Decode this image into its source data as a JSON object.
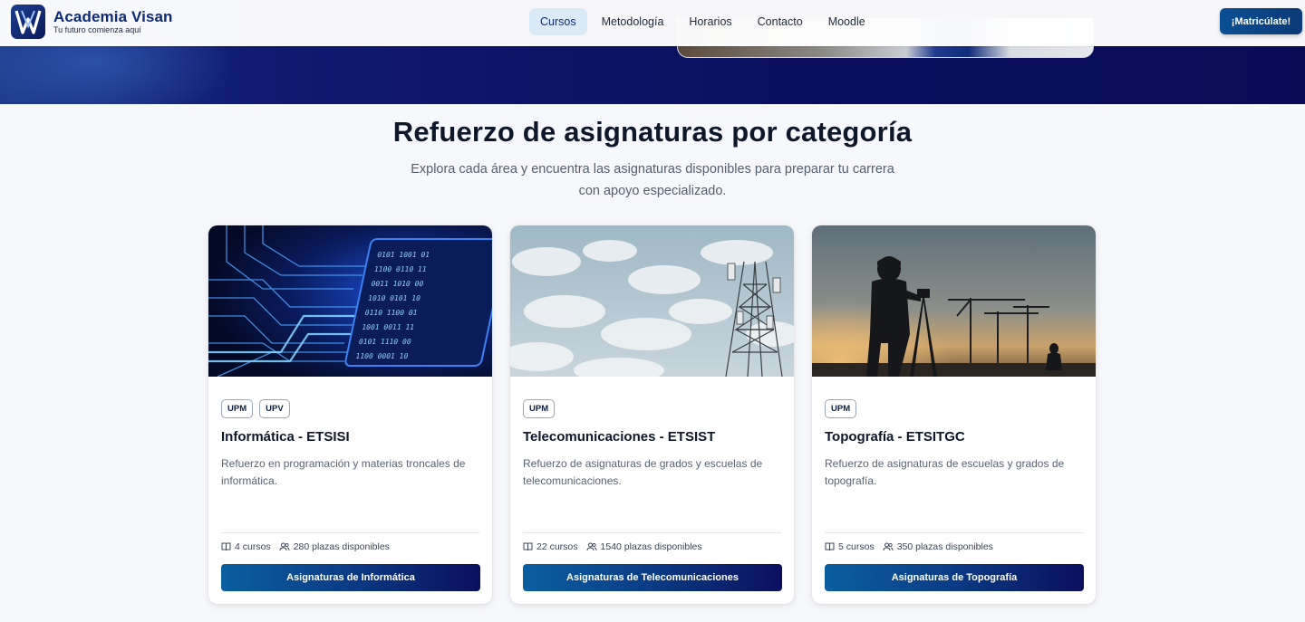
{
  "header": {
    "brand_name": "Academia Visan",
    "brand_tagline": "Tu futuro comienza aquí",
    "nav": [
      {
        "label": "Cursos",
        "active": true
      },
      {
        "label": "Metodología",
        "active": false
      },
      {
        "label": "Horarios",
        "active": false
      },
      {
        "label": "Contacto",
        "active": false
      },
      {
        "label": "Moodle",
        "active": false
      }
    ],
    "cta_label": "¡Matricúlate!"
  },
  "section": {
    "title": "Refuerzo de asignaturas por categoría",
    "subtitle": "Explora cada área y encuentra las asignaturas disponibles para preparar tu carrera con apoyo especializado."
  },
  "cards": [
    {
      "image": "circuit-board-photo",
      "badges": [
        "UPM",
        "UPV"
      ],
      "title": "Informática - ETSISI",
      "description": "Refuerzo en programación y materias troncales de informática.",
      "courses": "4 cursos",
      "seats": "280 plazas disponibles",
      "button": "Asignaturas de Informática"
    },
    {
      "image": "telecom-tower-photo",
      "badges": [
        "UPM"
      ],
      "title": "Telecomunicaciones - ETSIST",
      "description": "Refuerzo de asignaturas de grados y escuelas de telecomunicaciones.",
      "courses": "22 cursos",
      "seats": "1540 plazas disponibles",
      "button": "Asignaturas de Telecomunicaciones"
    },
    {
      "image": "surveyor-silhouette-photo",
      "badges": [
        "UPM"
      ],
      "title": "Topografía - ETSITGC",
      "description": "Refuerzo de asignaturas de escuelas y grados de topografía.",
      "courses": "5 cursos",
      "seats": "350 plazas disponibles",
      "button": "Asignaturas de Topografía"
    }
  ],
  "icons": {
    "courses": "book-icon",
    "seats": "users-icon"
  },
  "colors": {
    "brand": "#0b2a78",
    "hero": "#0b0f5e",
    "nav_active_bg": "#dbeaf7",
    "button_start": "#0b5fa0",
    "button_end": "#0b0f5e"
  }
}
